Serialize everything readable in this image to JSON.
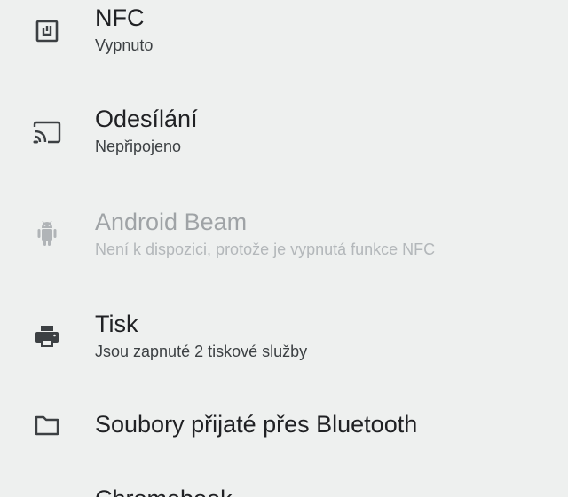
{
  "settings": {
    "items": [
      {
        "icon": "nfc-icon",
        "title": "NFC",
        "summary": "Vypnuto",
        "enabled": true
      },
      {
        "icon": "cast-icon",
        "title": "Odesílání",
        "summary": "Nepřipojeno",
        "enabled": true
      },
      {
        "icon": "android-icon",
        "title": "Android Beam",
        "summary": "Není k dispozici, protože je vypnutá funkce NFC",
        "enabled": false
      },
      {
        "icon": "printer-icon",
        "title": "Tisk",
        "summary": "Jsou zapnuté 2 tiskové služby",
        "enabled": true
      },
      {
        "icon": "folder-icon",
        "title": "Soubory přijaté přes Bluetooth",
        "enabled": true
      },
      {
        "title": "Chromebook",
        "enabled": true
      }
    ]
  },
  "colors": {
    "background": "#eef0ef",
    "icon": "#3c4043",
    "icon_disabled": "#b0b4b7",
    "title": "#202124",
    "disabled_text": "#9fa3a6"
  }
}
